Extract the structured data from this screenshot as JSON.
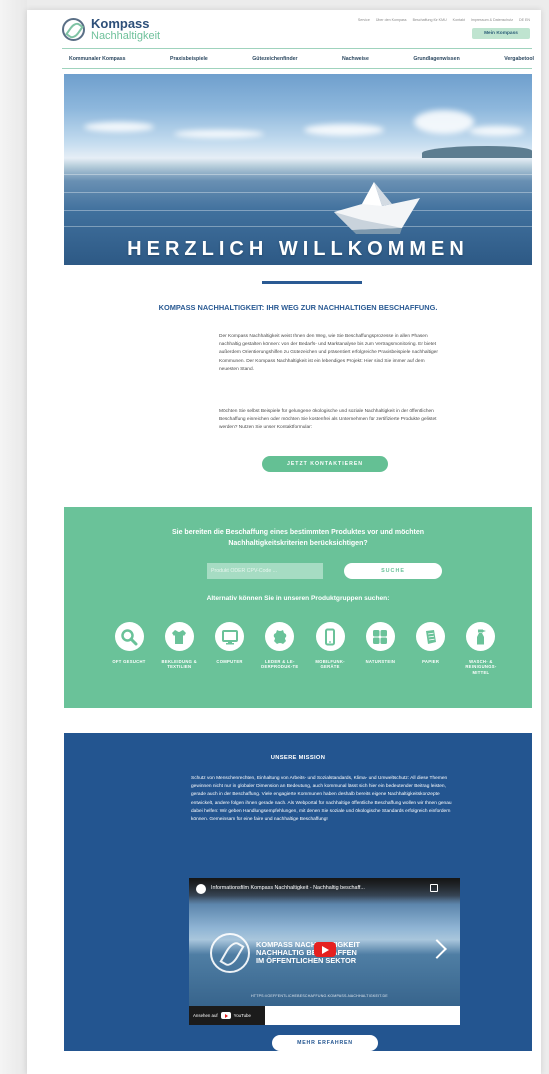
{
  "header": {
    "logo_line1": "Kompass",
    "logo_line2": "Nachhaltigkeit",
    "top_links": [
      "Service",
      "Über den Kompass",
      "Beschaffung für KMU",
      "Kontakt",
      "Impressum & Datenschutz",
      "DE   EN"
    ],
    "my_kompass_button": "Mein Kompass"
  },
  "nav": {
    "items": [
      "Kommunaler Kompass",
      "Praxisbeispiele",
      "Gütezeichenfinder",
      "Nachweise",
      "Grundlagenwissen",
      "Vergabetool"
    ]
  },
  "hero": {
    "title": "HERZLICH WILLKOMMEN"
  },
  "intro": {
    "heading": "KOMPASS NACHHALTIGKEIT: IHR WEG ZUR NACHHALTIGEN BESCHAFFUNG.",
    "paragraph1": "Der Kompass Nachhaltigkeit weist Ihnen den Weg, wie Sie Beschaffungsprozesse in allen Phasen nachhaltig gestalten können: von der Bedarfs- und Marktanalyse bis zum Vertragsmonitoring. Er bietet außerdem Orientierungshilfen zu Gütezeichen und präsentiert erfolgreiche Praxisbeispiele nachhaltiger Kommunen. Der Kompass Nachhaltigkeit ist ein lebendiges Projekt: Hier sind Sie immer auf dem neuesten Stand.",
    "paragraph2": "Möchten Sie selbst Beispiele für gelungene ökologische und soziale Nachhaltigkeit in der öffentlichen Beschaffung einreichen oder möchten Sie kostenfrei als Unternehmen für zertifizierte Produkte gelistet werden? Nutzen Sie unser Kontaktformular:",
    "contact_button": "JETZT KONTAKTIEREN"
  },
  "products": {
    "heading": "Sie bereiten die Beschaffung eines bestimmten Produktes vor und möchten Nachhaltigkeitskriterien berücksichtigen?",
    "search_placeholder": "Produkt ODER CPV-Code ...",
    "search_button": "SUCHE",
    "alt_text": "Alternativ können Sie in unseren Produktgruppen suchen:",
    "categories": [
      {
        "label": "OFT GESUCHT",
        "icon": "magnifier-icon"
      },
      {
        "label": "BEKLEIDUNG & TEXTILIEN",
        "icon": "shirt-icon"
      },
      {
        "label": "COMPUTER",
        "icon": "monitor-icon"
      },
      {
        "label": "LEDER & LE-DERPRODUK-TE",
        "icon": "leather-icon"
      },
      {
        "label": "MOBILFUNK-GERÄTE",
        "icon": "phone-icon"
      },
      {
        "label": "NATURSTEIN",
        "icon": "stone-icon"
      },
      {
        "label": "PAPIER",
        "icon": "paper-icon"
      },
      {
        "label": "WASCH- & REINIGUNGS-MITTEL",
        "icon": "spray-bottle-icon"
      }
    ]
  },
  "mission": {
    "heading": "UNSERE MISSION",
    "paragraph": "Schutz von Menschenrechten, Einhaltung von Arbeits- und Sozialstandards, Klima- und Umweltschutz: All diese Themen gewinnen nicht nur in globaler Dimension an Bedeutung, auch kommunal lässt sich hier ein bedeutender Beitrag leisten, gerade auch in der Beschaffung. Viele engagierte Kommunen haben deshalb bereits eigene Nachhaltigkeitskonzepte entwickelt, andere folgen ihnen gerade nach. Als Webportal für nachhaltige öffentliche Beschaffung wollen wir Ihnen genau dabei helfen: Wir geben Handlungsempfehlungen, mit denen Sie soziale und ökologische Standards erfolgreich einfordern können. Gemeinsam für eine faire und nachhaltige Beschaffung!",
    "video_title": "Informationsfilm Kompass Nachhaltigkeit - Nachhaltig beschaff...",
    "video_overlay_line1": "KOMPASS NACHHALTIGKEIT",
    "video_overlay_line2": "NACHHALTIG BESCHAFFEN",
    "video_overlay_line3": "IM ÖFFENTLICHEN SEKTOR",
    "video_url": "HTTPS://OEFFENTLICHEBESCHAFFUNG.KOMPASS-NACHHALTIGKEIT.DE",
    "watch_on": "Ansehen auf",
    "youtube": "YouTube",
    "more_button": "MEHR ERFAHREN"
  },
  "colors": {
    "brand_blue": "#2a5a93",
    "brand_green": "#64c094",
    "mission_blue": "#235590"
  }
}
